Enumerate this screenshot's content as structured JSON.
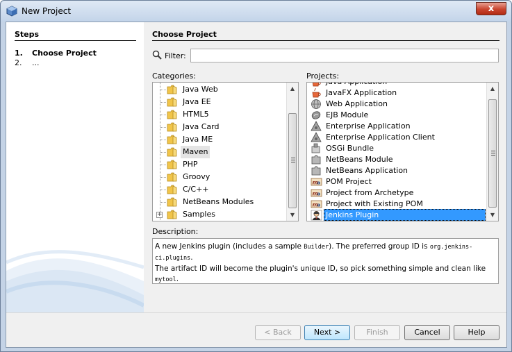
{
  "window": {
    "title": "New Project",
    "close_glyph": "x"
  },
  "steps": {
    "title": "Steps",
    "items": [
      {
        "num": "1.",
        "label": "Choose Project"
      },
      {
        "num": "2.",
        "label": "..."
      }
    ]
  },
  "main": {
    "title": "Choose Project",
    "filter": {
      "label": "Filter:",
      "value": ""
    },
    "categories_label": "Categories:",
    "projects_label": "Projects:",
    "categories": [
      {
        "label": "Java Web"
      },
      {
        "label": "Java EE"
      },
      {
        "label": "HTML5"
      },
      {
        "label": "Java Card"
      },
      {
        "label": "Java ME"
      },
      {
        "label": "Maven",
        "selected": true
      },
      {
        "label": "PHP"
      },
      {
        "label": "Groovy"
      },
      {
        "label": "C/C++"
      },
      {
        "label": "NetBeans Modules"
      },
      {
        "label": "Samples",
        "expandable": true
      }
    ],
    "projects": [
      {
        "label": "Java Application",
        "icon": "cup-icon"
      },
      {
        "label": "JavaFX Application",
        "icon": "cup-icon"
      },
      {
        "label": "Web Application",
        "icon": "globe-icon"
      },
      {
        "label": "EJB Module",
        "icon": "bean-icon"
      },
      {
        "label": "Enterprise Application",
        "icon": "triangle-icon"
      },
      {
        "label": "Enterprise Application Client",
        "icon": "triangle-icon"
      },
      {
        "label": "OSGi Bundle",
        "icon": "osgi-icon"
      },
      {
        "label": "NetBeans Module",
        "icon": "puzzle-icon"
      },
      {
        "label": "NetBeans Application",
        "icon": "puzzle-icon"
      },
      {
        "label": "POM Project",
        "icon": "maven-icon"
      },
      {
        "label": "Project from Archetype",
        "icon": "maven-icon"
      },
      {
        "label": "Project with Existing POM",
        "icon": "maven-icon"
      },
      {
        "label": "Jenkins Plugin",
        "icon": "jenkins-icon",
        "selected": true
      }
    ],
    "description_label": "Description:",
    "description": {
      "p1": "A new Jenkins plugin (includes a sample ",
      "code1": "Builder",
      "p2": "). The preferred group ID is ",
      "code2": "org.jenkins-ci.plugins",
      "p3": ".",
      "p4": "The artifact ID will become the plugin's unique ID, so pick something simple and clean like ",
      "code3": "mytool",
      "p5": "."
    }
  },
  "buttons": {
    "back": "< Back",
    "next": "Next >",
    "finish": "Finish",
    "cancel": "Cancel",
    "help": "Help"
  },
  "colors": {
    "selection": "#3399ff",
    "folder": "#f1c54a",
    "frame": "#c4d3e6"
  }
}
